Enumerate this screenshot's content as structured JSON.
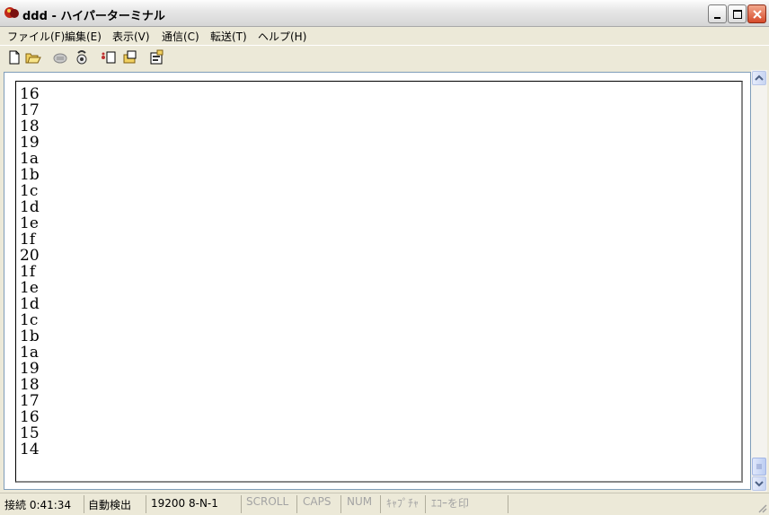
{
  "window": {
    "title": "ddd - ハイパーターミナル"
  },
  "menu": [
    "ファイル(F)",
    "編集(E)",
    "表示(V)",
    "通信(C)",
    "転送(T)",
    "ヘルプ(H)"
  ],
  "toolbar": [
    "new-icon",
    "open-icon",
    "disconnect-icon",
    "dial-icon",
    "send-icon",
    "receive-icon",
    "properties-icon"
  ],
  "terminal": {
    "lines": [
      "16",
      "17",
      "18",
      "19",
      "1a",
      "1b",
      "1c",
      "1d",
      "1e",
      "1f",
      "20",
      "1f",
      "1e",
      "1d",
      "1c",
      "1b",
      "1a",
      "19",
      "18",
      "17",
      "16",
      "15",
      "14"
    ]
  },
  "status": {
    "connection": "接続 0:41:34",
    "detect": "自動検出",
    "port": "19200 8-N-1",
    "scroll": "SCROLL",
    "caps": "CAPS",
    "num": "NUM",
    "capture": "ｷｬﾌﾟﾁｬ",
    "echo": "ｴｺｰを印"
  },
  "colors": {
    "close_button": "#d64a2a",
    "terminal_bg": "#ffffff",
    "chrome": "#ece9d8"
  }
}
